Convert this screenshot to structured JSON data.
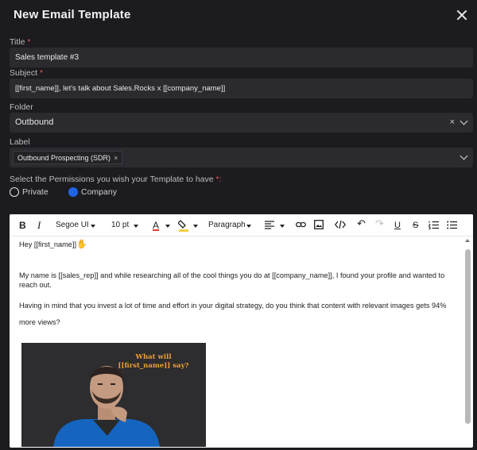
{
  "modal": {
    "title": "New Email Template"
  },
  "fields": {
    "title": {
      "label": "Title",
      "required": "*",
      "value": "Sales template #3"
    },
    "subject": {
      "label": "Subject",
      "required": "*",
      "value": "[[first_name]], let's talk about Sales.Rocks x [[company_name]]"
    },
    "folder": {
      "label": "Folder",
      "value": "Outbound",
      "clear": "×"
    },
    "label": {
      "label": "Label",
      "chip": "Outbound Prospecting (SDR)",
      "chip_remove": "×"
    }
  },
  "permissions": {
    "label": "Select the Permissions you wish your Template to have",
    "required": "*:",
    "options": [
      {
        "label": "Private",
        "selected": false
      },
      {
        "label": "Company",
        "selected": true
      }
    ]
  },
  "toolbar": {
    "bold": "B",
    "italic": "I",
    "font": "Segoe UI",
    "size": "10 pt",
    "text_color": "A",
    "block": "Paragraph",
    "undo": "↶",
    "redo": "↷",
    "underline": "U",
    "strike": "S"
  },
  "content": {
    "greeting": "Hey [[first_name]]",
    "para1": "My name is [[sales_rep]] and while researching all of the cool things you do at [[company_name]], I found your profile and wanted to reach out.",
    "para2": "Having in mind that you invest a lot of time and effort in your digital strategy, do you think that content with relevant images gets 94% more views?",
    "image_text_line1": "What will",
    "image_text_line2": "[[first_name]] say?"
  },
  "colors": {
    "accent": "#1e64e6",
    "bg": "#1c1b1f",
    "field": "#2b2a2f",
    "required": "#e05b5b",
    "image_text": "#f0a030"
  }
}
